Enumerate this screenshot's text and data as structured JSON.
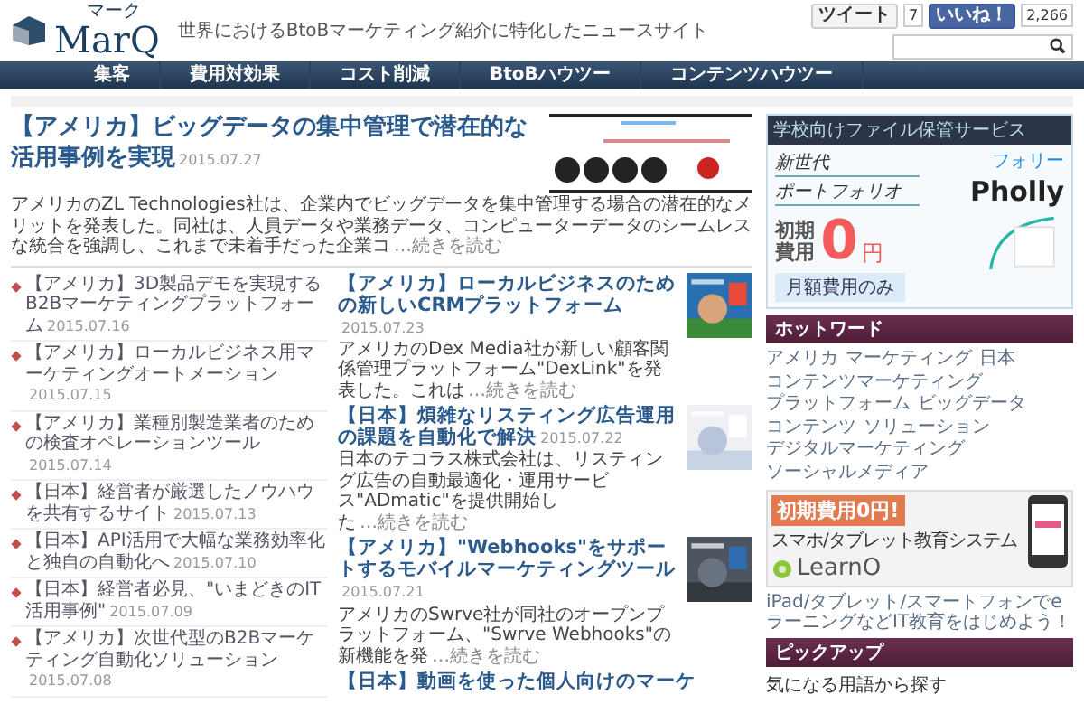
{
  "header": {
    "logo": "MarQ",
    "logo_ruby": "マーク",
    "tagline": "世界におけるBtoBマーケティング紹介に特化したニュースサイト",
    "tweet": {
      "label": "ツイート",
      "count": "7"
    },
    "like": {
      "label": "いいね！",
      "count": "2,266"
    }
  },
  "nav": [
    "集客",
    "費用対効果",
    "コスト削減",
    "BtoBハウツー",
    "コンテンツハウツー"
  ],
  "feature": {
    "title": "【アメリカ】ビッグデータの集中管理で潜在的な活用事例を実現",
    "date": "2015.07.27",
    "body": "アメリカのZL Technologies社は、企業内でビッグデータを集中管理する場合の潜在的なメリットを発表した。同社は、人員データや業務データ、コンピューターデータのシームレスな統合を強調し、これまで未着手だった企業コ",
    "more": "…続きを読む"
  },
  "recent": [
    {
      "title": "【アメリカ】3D製品デモを実現するB2Bマーケティングプラットフォーム",
      "date": "2015.07.16"
    },
    {
      "title": "【アメリカ】ローカルビジネス用マーケティングオートメーション",
      "date": "2015.07.15"
    },
    {
      "title": "【アメリカ】業種別製造業者のための検査オペレーションツール",
      "date": "2015.07.14"
    },
    {
      "title": "【日本】経営者が厳選したノウハウを共有するサイト",
      "date": "2015.07.13"
    },
    {
      "title": "【日本】API活用で大幅な業務効率化と独自の自動化へ",
      "date": "2015.07.10"
    },
    {
      "title": "【日本】経営者必見、\"いまどきのIT活用事例\"",
      "date": "2015.07.09"
    },
    {
      "title": "【アメリカ】次世代型のB2Bマーケティング自動化ソリューション",
      "date": "2015.07.08"
    }
  ],
  "articles": [
    {
      "title": "【アメリカ】ローカルビジネスのための新しいCRMプラットフォーム",
      "date": "2015.07.23",
      "body": "アメリカのDex Media社が新しい顧客関係管理プラットフォーム\"DexLink\"を発表した。これは",
      "more": "…続きを読む"
    },
    {
      "title": "【日本】煩雑なリスティング広告運用の課題を自動化で解決",
      "date": "2015.07.22",
      "body": "日本のテコラス株式会社は、リスティング広告の自動最適化・運用サービス\"ADmatic\"を提供開始した",
      "more": "…続きを読む"
    },
    {
      "title": "【アメリカ】\"Webhooks\"をサポートするモバイルマーケティングツール",
      "date": "2015.07.21",
      "body": "アメリカのSwrve社が同社のオープンプラットフォーム、\"Swrve Webhooks\"の新機能を発",
      "more": "…続きを読む"
    },
    {
      "title": "【日本】動画を使った個人向けのマーケ"
    }
  ],
  "sidebar": {
    "ad_top": {
      "heading": "学校向けファイル保管サービス",
      "line_1": "新世代",
      "line_2": "ポートフォリオ",
      "kana": "フォリー",
      "name": "Pholly",
      "cost_1": "初期",
      "cost_2": "費用",
      "zero": "0",
      "yen": "円",
      "note": "月額費用のみ"
    },
    "hot_words": {
      "heading": "ホットワード",
      "words": [
        "アメリカ",
        "マーケティング",
        "日本",
        "コンテンツマーケティング",
        "プラットフォーム",
        "ビッグデータ",
        "コンテンツ",
        "ソリューション",
        "デジタルマーケティング",
        "ソーシャルメディア"
      ]
    },
    "ad_bottom": {
      "ribbon": "初期費用0円!",
      "tagline": "スマホ/タブレット教育システム",
      "name": "LearnO",
      "caption": "iPad/タブレット/スマートフォンでeラーニングなどIT教育をはじめよう！"
    },
    "pickup": {
      "heading": "ピックアップ",
      "items": [
        "気になる用語から探す"
      ]
    }
  }
}
